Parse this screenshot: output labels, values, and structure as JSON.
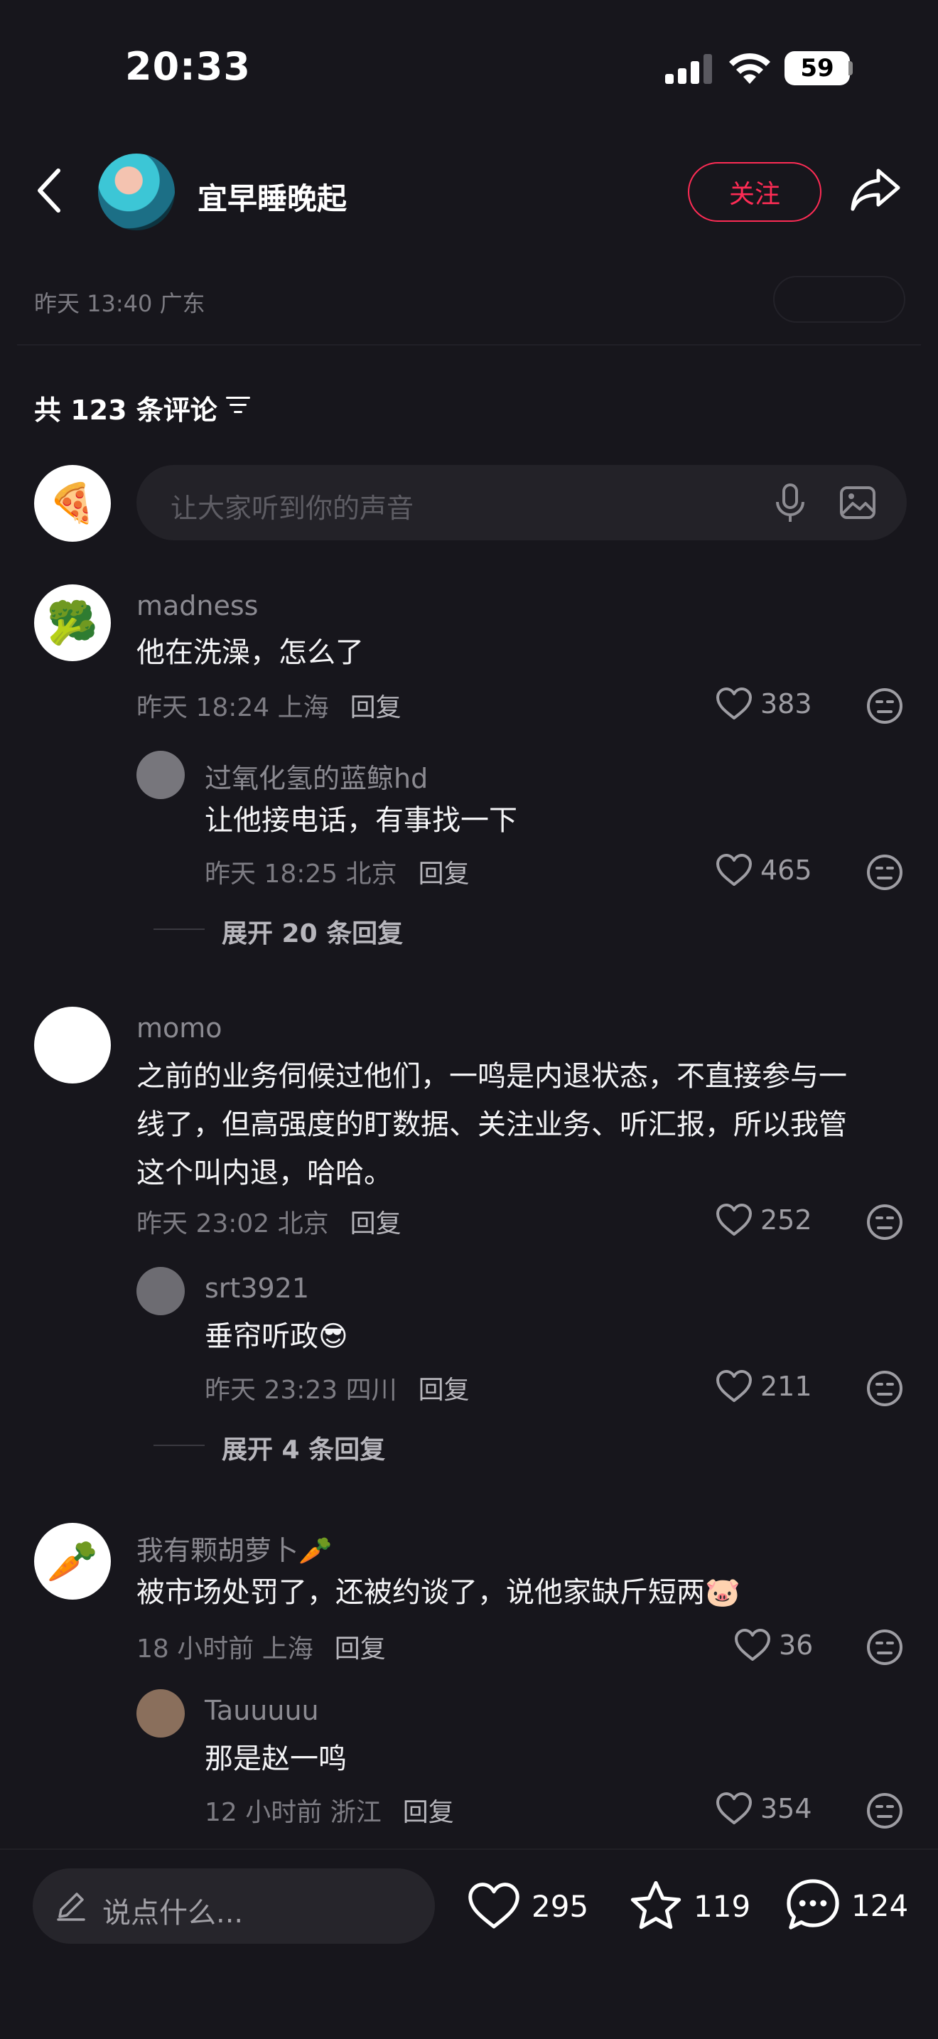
{
  "status_bar": {
    "time": "20:33",
    "battery": "59"
  },
  "header": {
    "username": "宜早睡晚起",
    "follow_label": "关注"
  },
  "post_meta": "昨天 13:40 广东",
  "comments_count_label": "共 123 条评论",
  "input": {
    "placeholder": "让大家听到你的声音"
  },
  "comments": [
    {
      "name": "madness",
      "text": "他在洗澡，怎么了",
      "meta": "昨天 18:24 上海",
      "reply": "回复",
      "likes": "383",
      "replies": [
        {
          "name": "过氧化氢的蓝鲸hd",
          "text": "让他接电话，有事找一下",
          "meta": "昨天 18:25 北京",
          "reply": "回复",
          "likes": "465"
        }
      ],
      "expand": "展开 20 条回复"
    },
    {
      "name": "momo",
      "text_lines": [
        "之前的业务伺候过他们，一鸣是内退状态，不直接参与一",
        "线了，但高强度的盯数据、关注业务、听汇报，所以我管",
        "这个叫内退，哈哈。"
      ],
      "meta": "昨天 23:02 北京",
      "reply": "回复",
      "likes": "252",
      "replies": [
        {
          "name": "srt3921",
          "text": "垂帘听政",
          "meta": "昨天 23:23 四川",
          "reply": "回复",
          "likes": "211"
        }
      ],
      "expand": "展开 4 条回复"
    },
    {
      "name": "我有颗胡萝卜",
      "text": "被市场处罚了，还被约谈了，说他家缺斤短两",
      "meta": "18 小时前 上海",
      "reply": "回复",
      "likes": "36",
      "replies": [
        {
          "name": "Tauuuuu",
          "text": "那是赵一鸣",
          "meta": "12 小时前 浙江",
          "reply": "回复",
          "likes": "354"
        }
      ]
    }
  ],
  "bottom_bar": {
    "input_placeholder": "说点什么...",
    "likes": "295",
    "favorites": "119",
    "comments": "124"
  },
  "colors": {
    "background": "#17161c",
    "accent": "#fe2c55",
    "muted": "#7d7c83"
  }
}
